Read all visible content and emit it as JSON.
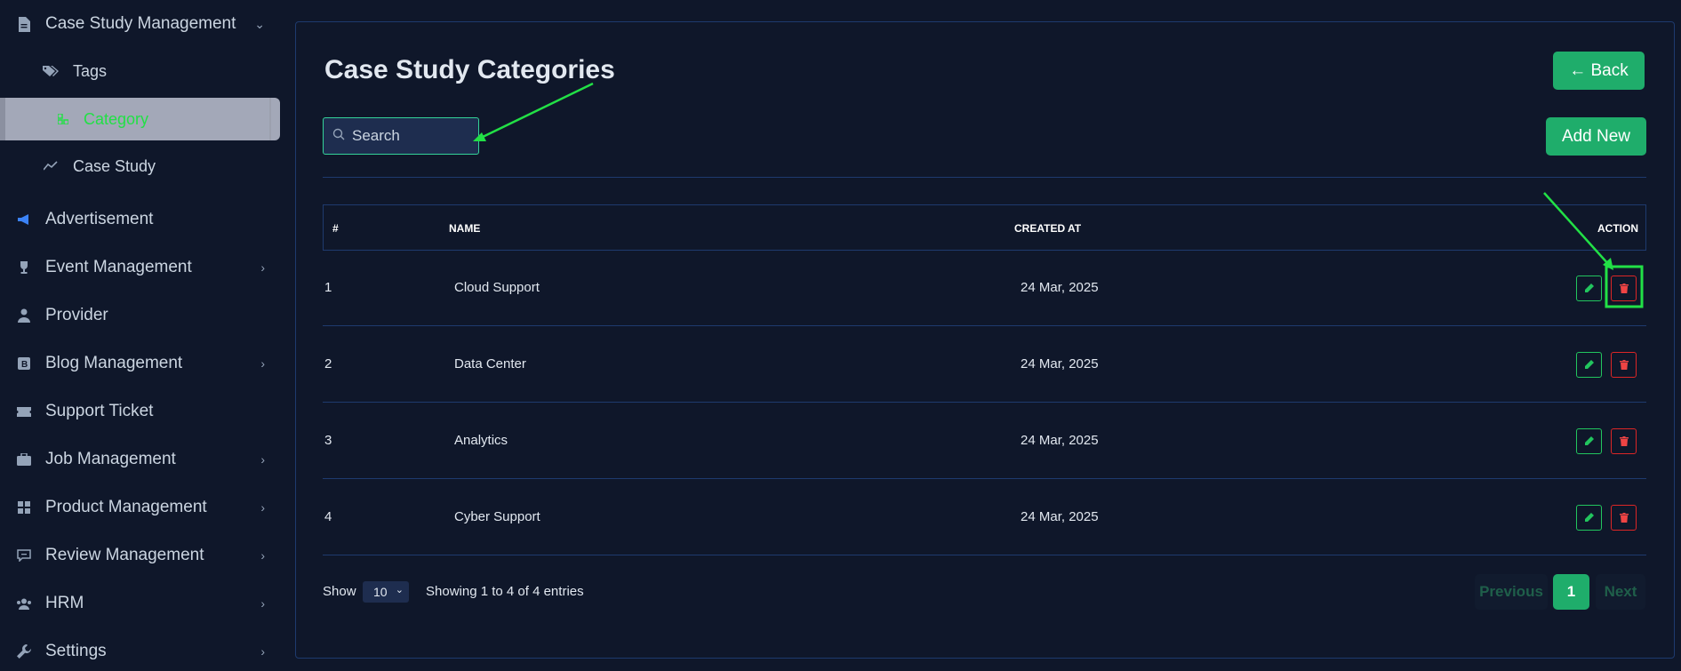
{
  "sidebar": {
    "items": [
      {
        "label": "Case Study Management",
        "icon": "document-icon",
        "chevron": "⌄"
      },
      {
        "label": "Tags",
        "icon": "tags-icon"
      },
      {
        "label": "Category",
        "icon": "category-icon"
      },
      {
        "label": "Case Study",
        "icon": "trend-icon"
      },
      {
        "label": "Advertisement",
        "icon": "megaphone-icon"
      },
      {
        "label": "Event Management",
        "icon": "trophy-icon",
        "chevron": "›"
      },
      {
        "label": "Provider",
        "icon": "user-tie-icon"
      },
      {
        "label": "Blog Management",
        "icon": "blog-icon",
        "chevron": "›"
      },
      {
        "label": "Support Ticket",
        "icon": "ticket-icon"
      },
      {
        "label": "Job Management",
        "icon": "briefcase-icon",
        "chevron": "›"
      },
      {
        "label": "Product Management",
        "icon": "grid-icon",
        "chevron": "›"
      },
      {
        "label": "Review Management",
        "icon": "review-icon",
        "chevron": "›"
      },
      {
        "label": "HRM",
        "icon": "users-icon",
        "chevron": "›"
      },
      {
        "label": "Settings",
        "icon": "wrench-icon",
        "chevron": "›"
      }
    ]
  },
  "main": {
    "title": "Case Study Categories",
    "back_label": "← Back",
    "add_new_label": "Add New",
    "search_placeholder": "Search",
    "table": {
      "headers": [
        "#",
        "NAME",
        "CREATED AT",
        "ACTION"
      ],
      "rows": [
        {
          "num": "1",
          "name": "Cloud Support",
          "created": "24 Mar, 2025"
        },
        {
          "num": "2",
          "name": "Data Center",
          "created": "24 Mar, 2025"
        },
        {
          "num": "3",
          "name": "Analytics",
          "created": "24 Mar, 2025"
        },
        {
          "num": "4",
          "name": "Cyber Support",
          "created": "24 Mar, 2025"
        }
      ]
    },
    "footer": {
      "show_label": "Show",
      "page_size": "10",
      "entries_text": "Showing 1 to 4 of 4 entries",
      "prev_label": "Previous",
      "current_page": "1",
      "next_label": "Next"
    }
  },
  "colors": {
    "accent_green": "#1fad6b",
    "delete_red": "#dc2626",
    "annotation_green": "#22e046"
  }
}
